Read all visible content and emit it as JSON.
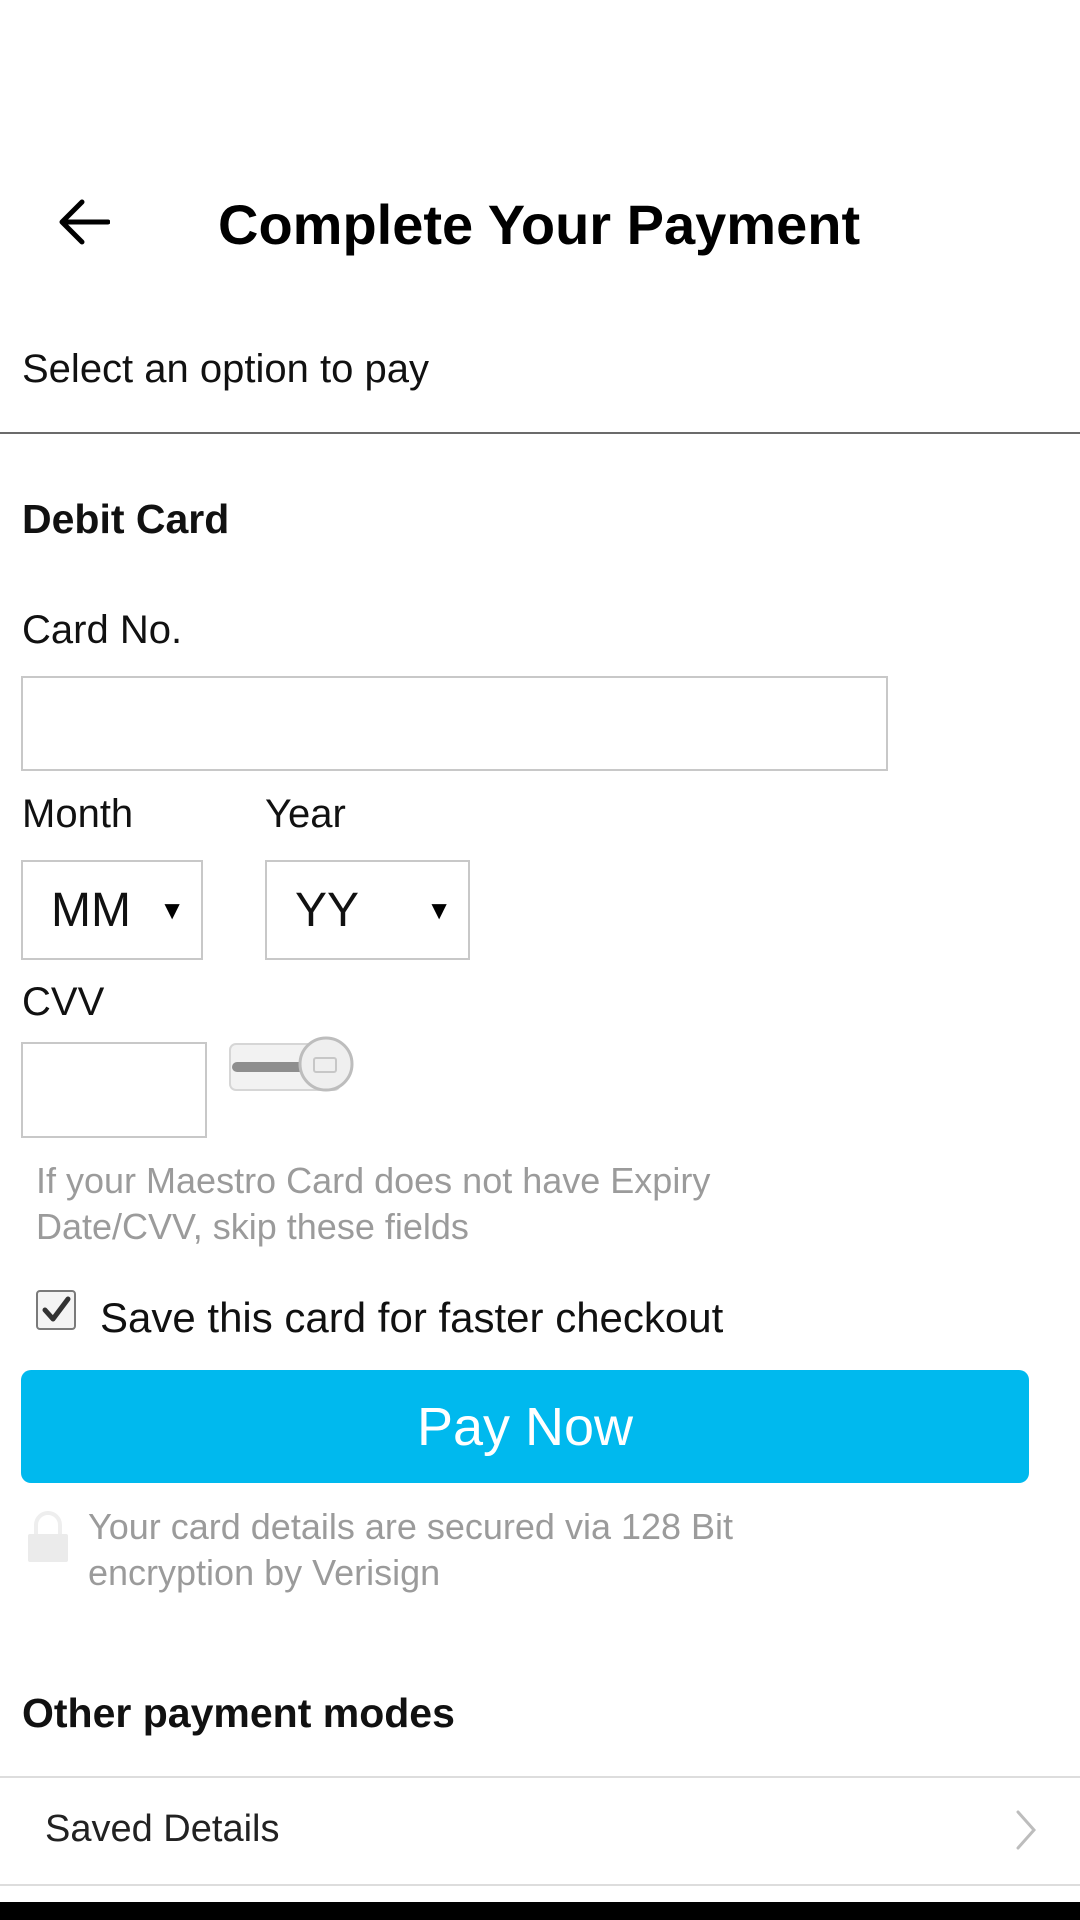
{
  "header": {
    "title": "Complete Your Payment",
    "back_icon": "arrow-left-icon"
  },
  "subtitle": "Select an option to pay",
  "debit_card": {
    "section_title": "Debit Card",
    "card_no_label": "Card No.",
    "card_no_value": "",
    "month_label": "Month",
    "month_value": "MM",
    "year_label": "Year",
    "year_value": "YY",
    "cvv_label": "CVV",
    "cvv_value": "",
    "hint": "If your Maestro Card does not have Expiry Date/CVV, skip these fields",
    "save_card_label": "Save this card for faster checkout",
    "save_card_checked": true,
    "pay_button": "Pay Now",
    "secure_note": "Your card details are secured via 128 Bit encryption by Verisign"
  },
  "other_modes": {
    "section_title": "Other payment modes",
    "items": [
      {
        "label": "Saved Details",
        "icon": "chevron-right-icon"
      }
    ]
  },
  "colors": {
    "primary": "#00b9ee",
    "hint_text": "#9b9b9b",
    "divider": "#6b6b6b"
  }
}
